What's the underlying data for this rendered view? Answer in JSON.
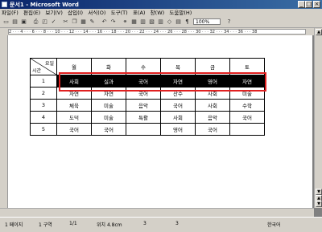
{
  "window": {
    "title": "문서1 - Microsoft Word"
  },
  "menu": [
    "파일(F)",
    "편집(E)",
    "보기(V)",
    "삽입(I)",
    "서식(O)",
    "도구(T)",
    "표(A)",
    "창(W)",
    "도움말(H)"
  ],
  "toolbar": {
    "zoom": "100%"
  },
  "table": {
    "header_corner_top": "요일",
    "header_corner_bottom": "시간",
    "days": [
      "월",
      "화",
      "수",
      "목",
      "금",
      "토"
    ],
    "rows": [
      {
        "period": "1",
        "cells": [
          "사회",
          "실과",
          "국어",
          "자연",
          "영어",
          "자연"
        ],
        "selected": true
      },
      {
        "period": "2",
        "cells": [
          "자연",
          "자연",
          "국어",
          "산수",
          "사회",
          "미술"
        ],
        "selected": false
      },
      {
        "period": "3",
        "cells": [
          "체육",
          "미술",
          "음악",
          "국어",
          "사회",
          "수학"
        ],
        "selected": false
      },
      {
        "period": "4",
        "cells": [
          "도덕",
          "미술",
          "특활",
          "사회",
          "음악",
          "국어"
        ],
        "selected": false
      },
      {
        "period": "5",
        "cells": [
          "국어",
          "국어",
          "",
          "영어",
          "국어",
          ""
        ],
        "selected": false
      }
    ]
  },
  "status": {
    "page": "1 페이지",
    "section": "1 구역",
    "pages": "1/1",
    "position": "위치 4.8cm",
    "line": "3",
    "col": "3",
    "lang": "한국어"
  },
  "colors": {
    "titlebar": "#0a246a",
    "highlight_box": "#e02020",
    "selection": "#000000"
  }
}
